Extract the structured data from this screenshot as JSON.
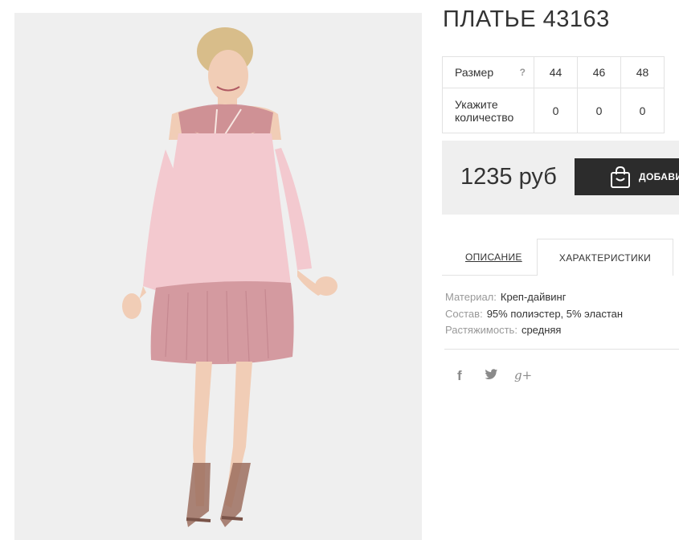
{
  "product": {
    "title": "ПЛАТЬЕ 43163",
    "image_alt": "Платье 43163"
  },
  "size_table": {
    "size_label": "Размер",
    "help_glyph": "?",
    "sizes": [
      "44",
      "46",
      "48"
    ],
    "qty_label": "Укажите количество",
    "quantities": [
      "0",
      "0",
      "0"
    ]
  },
  "purchase": {
    "price": "1235 руб",
    "add_button_label": "ДОБАВИТЬ",
    "add_button_icon": "shopping-bag-icon"
  },
  "tabs": [
    {
      "label": "ОПИСАНИЕ",
      "active": false
    },
    {
      "label": "ХАРАКТЕРИСТИКИ",
      "active": true
    }
  ],
  "characteristics": [
    {
      "key": "Материал:",
      "value": "Креп-дайвинг"
    },
    {
      "key": "Состав:",
      "value": "95% полиэстер, 5% эластан"
    },
    {
      "key": "Растяжимость:",
      "value": "средняя"
    }
  ],
  "social": [
    {
      "name": "facebook-icon",
      "glyph": "f"
    },
    {
      "name": "twitter-icon",
      "glyph": "🐦"
    },
    {
      "name": "google-plus-icon",
      "glyph": "g+"
    }
  ],
  "colors": {
    "photo_bg": "#efefef",
    "dress_light": "#f3c9cf",
    "dress_dark": "#d49aa0",
    "button_bg": "#2c2c2c",
    "price_bg": "#efefef",
    "border": "#e2e2e2"
  }
}
